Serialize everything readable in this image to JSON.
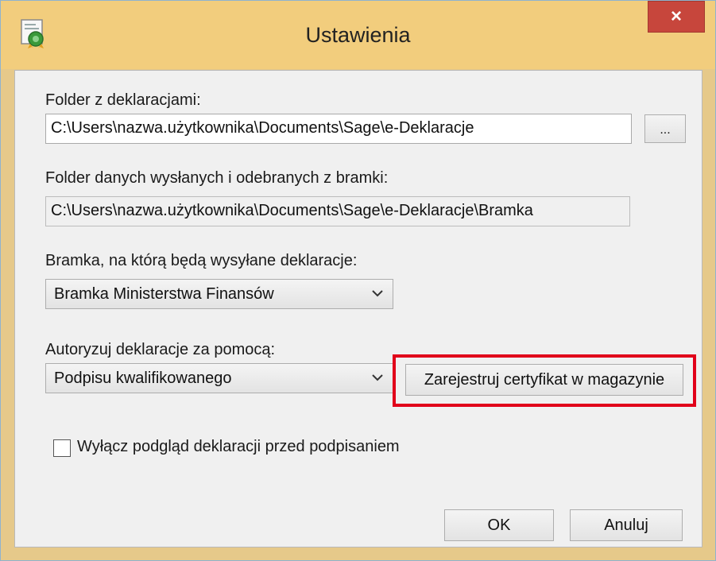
{
  "window": {
    "title": "Ustawienia",
    "close_label": "×"
  },
  "folder_decl": {
    "label": "Folder z deklaracjami:",
    "value": "C:\\Users\\nazwa.użytkownika\\Documents\\Sage\\e-Deklaracje",
    "browse_label": "..."
  },
  "folder_gate": {
    "label": "Folder danych wysłanych i odebranych z bramki:",
    "value": "C:\\Users\\nazwa.użytkownika\\Documents\\Sage\\e-Deklaracje\\Bramka"
  },
  "gateway": {
    "label": "Bramka, na którą będą wysyłane deklaracje:",
    "selected": "Bramka Ministerstwa Finansów"
  },
  "auth": {
    "label": "Autoryzuj deklaracje za pomocą:",
    "selected": "Podpisu kwalifikowanego",
    "register_label": "Zarejestruj certyfikat w magazynie"
  },
  "preview": {
    "label": "Wyłącz podgląd deklaracji przed podpisaniem",
    "checked": false
  },
  "footer": {
    "ok_label": "OK",
    "cancel_label": "Anuluj"
  },
  "colors": {
    "highlight": "#e1001a",
    "close_bg": "#c7463c"
  }
}
